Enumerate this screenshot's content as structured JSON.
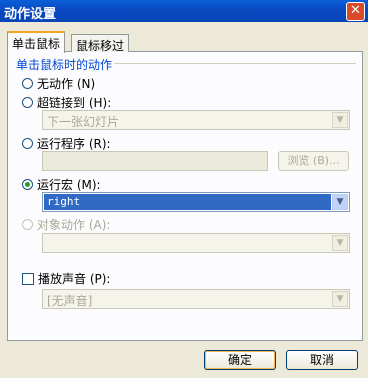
{
  "window": {
    "title": "动作设置",
    "close_label": "✕"
  },
  "tabs": [
    "单击鼠标",
    "鼠标移过"
  ],
  "group_title": "单击鼠标时的动作",
  "options": {
    "none": "无动作 (N)",
    "hyperlink": "超链接到 (H):",
    "run_program": "运行程序 (R):",
    "run_macro": "运行宏 (M):",
    "object_action": "对象动作 (A):",
    "play_sound": "播放声音 (P):"
  },
  "hyperlink_value": "下一张幻灯片",
  "program_path": "",
  "browse_label": "浏览 (B)...",
  "macro_value": "right",
  "object_action_value": "",
  "sound_value": "[无声音]",
  "buttons": {
    "ok": "确定",
    "cancel": "取消"
  },
  "selected_option": "run_macro",
  "colors": {
    "titlebar": "#0a5fd8",
    "group_title": "#0046d5",
    "selection": "#316ac5"
  }
}
